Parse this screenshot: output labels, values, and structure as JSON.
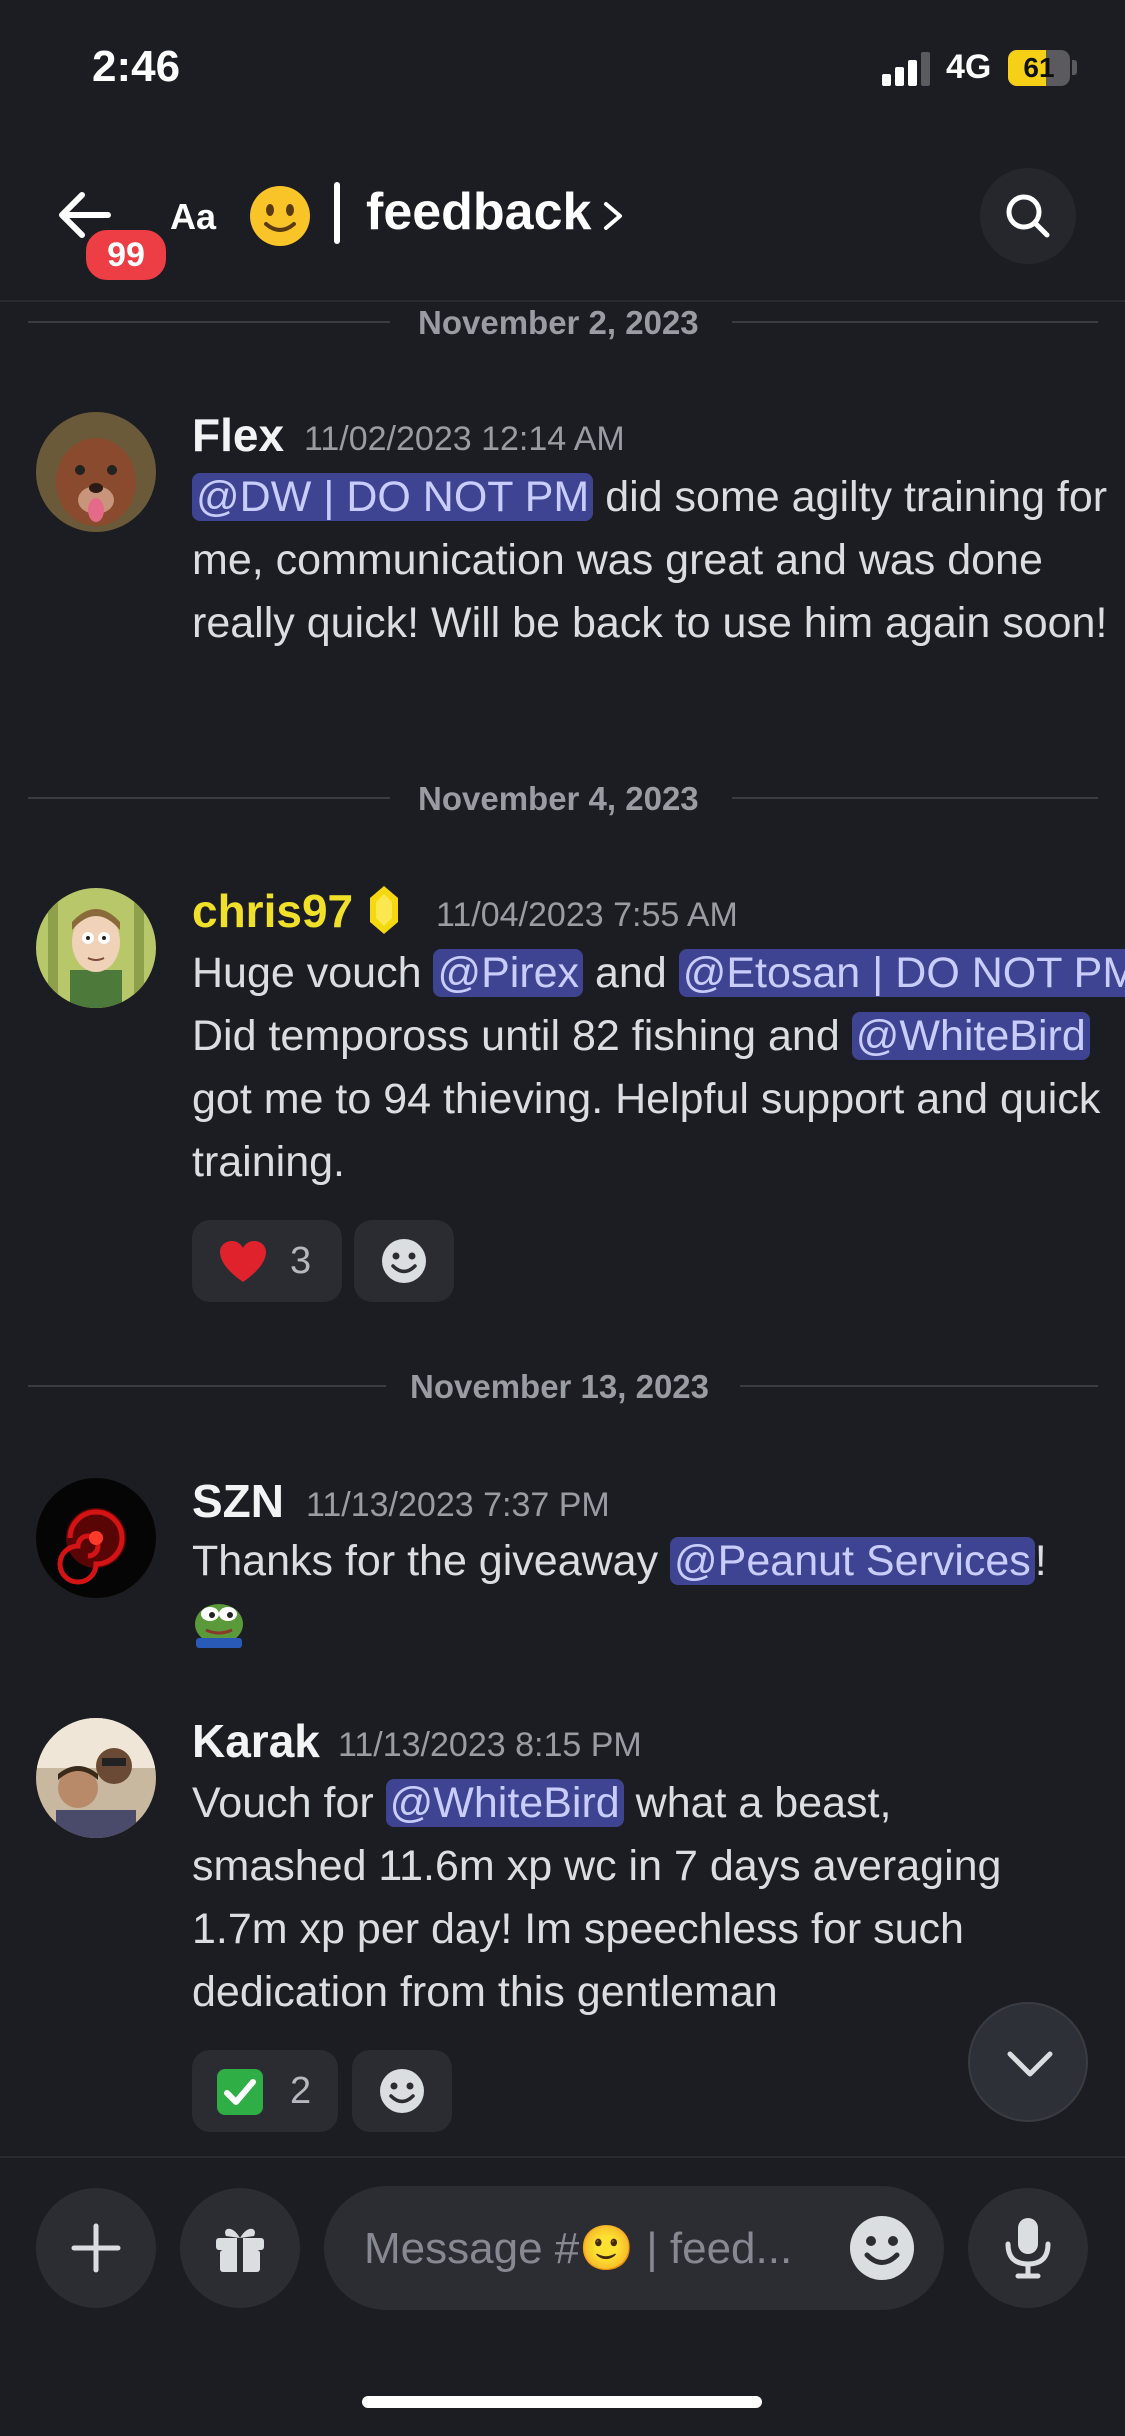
{
  "status_bar": {
    "time": "2:46",
    "network": "4G",
    "battery": "61",
    "battery_fraction": 0.61,
    "battery_color": "#f5d017"
  },
  "header": {
    "back_icon": "arrow-left-icon",
    "unread_badge": "99",
    "text_size_label": "Aa",
    "channel_emoji": "slightly-smiling-face",
    "channel_name": "feedback",
    "chevron_icon": "chevron-right-icon",
    "search_icon": "search-icon"
  },
  "messages": [
    {
      "date_divider": "November 2, 2023",
      "username": "Flex",
      "username_color": "#f2f3f5",
      "timestamp": "11/02/2023 12:14 AM",
      "segments": [
        {
          "mention": "@DW | DO NOT PM"
        },
        {
          "text": " did some agilty training for me, communication was great and was done really quick! Will be back to use him again soon!"
        }
      ],
      "reactions": []
    },
    {
      "date_divider": "November 4, 2023",
      "username": "chris97",
      "username_color": "#f0e02a",
      "role_icon": "yellow-gem-icon",
      "timestamp": "11/04/2023 7:55 AM",
      "segments": [
        {
          "text": "Huge vouch "
        },
        {
          "mention": "@Pirex"
        },
        {
          "text": " and "
        },
        {
          "mention": "@Etosan | DO NOT PM"
        },
        {
          "text": "   Did tempoross until 82 fishing and "
        },
        {
          "mention": "@WhiteBird"
        },
        {
          "text": " got me to 94 thieving. Helpful support and quick training."
        }
      ],
      "reactions": [
        {
          "emoji": "red-heart",
          "count": "3"
        }
      ]
    },
    {
      "date_divider": "November 13, 2023",
      "username": "SZN",
      "username_color": "#f2f3f5",
      "timestamp": "11/13/2023 7:37 PM",
      "segments": [
        {
          "text": "Thanks for the giveaway "
        },
        {
          "mention": "@Peanut Services"
        },
        {
          "text": "!"
        }
      ],
      "custom_emoji": "pepe-frog-emoji",
      "reactions": []
    },
    {
      "username": "Karak",
      "username_color": "#f2f3f5",
      "timestamp": "11/13/2023 8:15 PM",
      "segments": [
        {
          "text": "Vouch for "
        },
        {
          "mention": "@WhiteBird"
        },
        {
          "text": " what a beast, smashed 11.6m xp wc in 7 days averaging 1.7m xp per day! Im speechless for such dedication from this gentleman"
        }
      ],
      "reactions": [
        {
          "emoji": "check-mark-button",
          "count": "2"
        }
      ]
    }
  ],
  "composer": {
    "placeholder": "Message #🙂 | feed...",
    "plus_icon": "plus-icon",
    "gift_icon": "gift-icon",
    "emoji_icon": "emoji-smile-icon",
    "mic_icon": "microphone-icon"
  },
  "colors": {
    "background": "#1c1d22",
    "mention_bg": "#3e4491",
    "mention_fg": "#c9cdfb",
    "notification_red": "#ec3e44"
  }
}
